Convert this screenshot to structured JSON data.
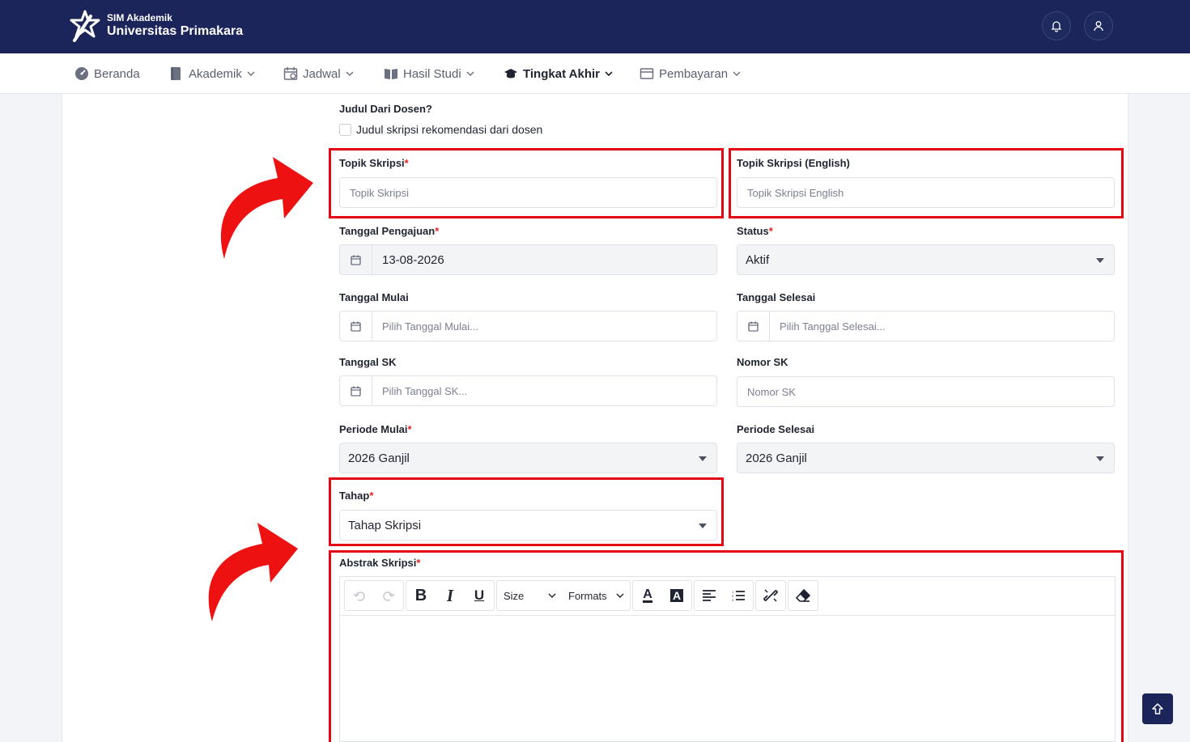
{
  "header": {
    "brand_sub": "SIM Akademik",
    "brand_main": "Universitas Primakara",
    "icons": [
      "logo-icon",
      "bell-icon",
      "user-icon"
    ]
  },
  "nav": {
    "items": [
      {
        "label": "Beranda",
        "icon": "dashboard-icon"
      },
      {
        "label": "Akademik",
        "icon": "book-icon"
      },
      {
        "label": "Jadwal",
        "icon": "calendar-icon"
      },
      {
        "label": "Hasil Studi",
        "icon": "open-book-icon"
      },
      {
        "label": "Tingkat Akhir",
        "icon": "graduation-cap-icon"
      },
      {
        "label": "Pembayaran",
        "icon": "payment-icon"
      }
    ],
    "active": "Tingkat Akhir"
  },
  "form": {
    "judul_dosen": {
      "label": "Judul Dari Dosen?",
      "checkbox_label": "Judul skripsi rekomendasi dari dosen"
    },
    "topik": {
      "label": "Topik Skripsi",
      "placeholder": "Topik Skripsi"
    },
    "topik_en": {
      "label": "Topik Skripsi (English)",
      "placeholder": "Topik Skripsi English"
    },
    "tgl_pengajuan": {
      "label": "Tanggal Pengajuan",
      "value": "13-08-2026"
    },
    "status": {
      "label": "Status",
      "value": "Aktif"
    },
    "tgl_mulai": {
      "label": "Tanggal Mulai",
      "placeholder": "Pilih Tanggal Mulai..."
    },
    "tgl_selesai": {
      "label": "Tanggal Selesai",
      "placeholder": "Pilih Tanggal Selesai..."
    },
    "tgl_sk": {
      "label": "Tanggal SK",
      "placeholder": "Pilih Tanggal SK..."
    },
    "nomor_sk": {
      "label": "Nomor SK",
      "placeholder": "Nomor SK"
    },
    "periode_mulai": {
      "label": "Periode Mulai",
      "value": "2026 Ganjil"
    },
    "periode_selesai": {
      "label": "Periode Selesai",
      "value": "2026 Ganjil"
    },
    "tahap": {
      "label": "Tahap",
      "value": "Tahap Skripsi"
    },
    "abstrak": {
      "label": "Abstrak Skripsi"
    },
    "required_mark": "*"
  },
  "editor": {
    "size_label": "Size",
    "formats_label": "Formats",
    "bold": "B",
    "italic": "I",
    "underline": "U",
    "font_color": "A",
    "bg_color": "A"
  },
  "colors": {
    "header_bg": "#1b2559",
    "highlight": "#e30613",
    "required": "#e02424"
  }
}
